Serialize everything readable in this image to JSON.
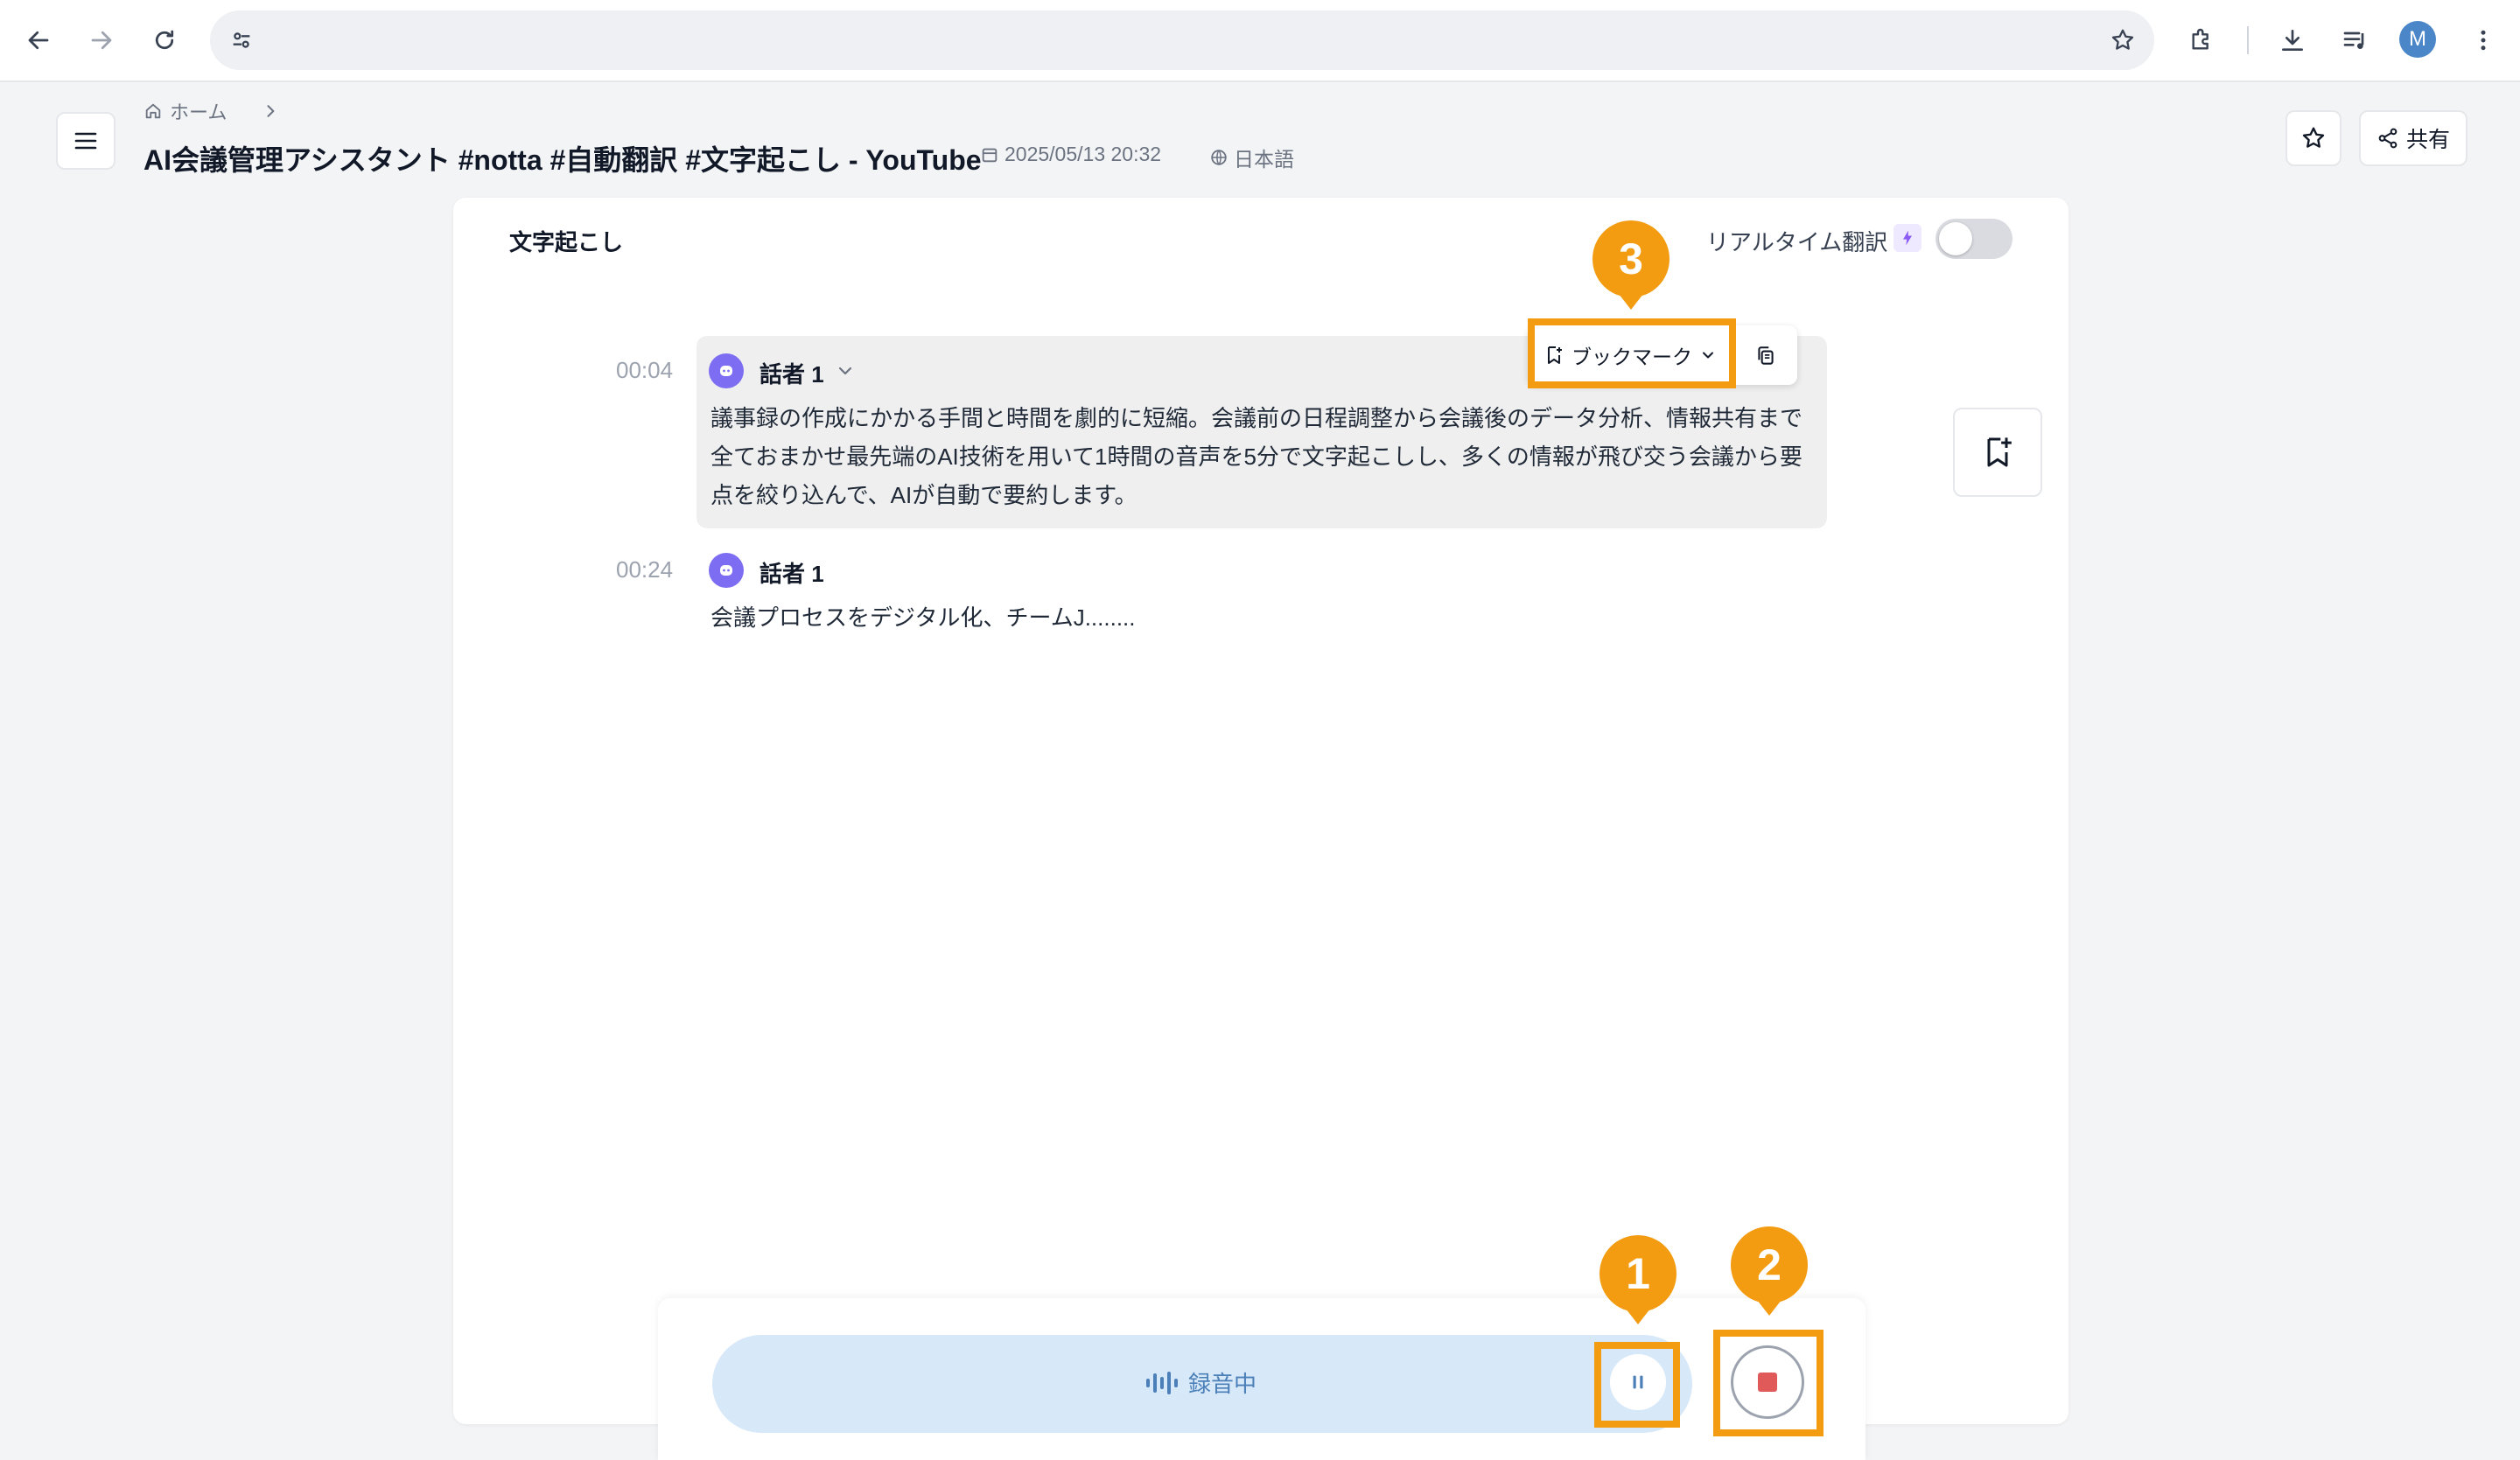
{
  "browser": {
    "back_icon": "arrow-left-icon",
    "forward_icon": "arrow-right-icon",
    "reload_icon": "reload-icon",
    "site_settings_icon": "tune-icon",
    "bookmark_icon": "star-outline-icon",
    "extensions_icon": "puzzle-icon",
    "download_icon": "download-icon",
    "media_icon": "playlist-icon",
    "profile_initial": "M",
    "menu_icon": "kebab-icon"
  },
  "header": {
    "breadcrumb_home": "ホーム",
    "title": "AI会議管理アシスタント #notta #自動翻訳 #文字起こし - YouTube",
    "date": "2025/05/13 20:32",
    "language": "日本語",
    "share_label": "共有"
  },
  "transcript": {
    "section_title": "文字起こし",
    "realtime_translation_label": "リアルタイム翻訳",
    "realtime_translation_enabled": false,
    "bookmark_label": "ブックマーク",
    "entries": [
      {
        "time": "00:04",
        "speaker": "話者 1",
        "lines": [
          "議事録の作成にかかる手間と時間を劇的に短縮。会議前の日程調整から会議後のデータ分析、情報共有まで",
          "全ておまかせ最先端のAI技術を用いて1時間の音声を5分で文字起こしし、多くの情報が飛び交う会議から要",
          "点を絞り込んで、AIが自動で要約します。"
        ]
      },
      {
        "time": "00:24",
        "speaker": "話者 1",
        "lines": [
          "会議プロセスをデジタル化、チームJ........"
        ]
      }
    ]
  },
  "recording": {
    "status": "録音中"
  },
  "callouts": [
    "1",
    "2",
    "3"
  ],
  "colors": {
    "accent_orange": "#f39c12",
    "recording_pill": "#d7e8f8",
    "recording_text": "#4b7fb8",
    "stop_red": "#e05a5a",
    "speaker_avatar": "#7c6df2"
  }
}
